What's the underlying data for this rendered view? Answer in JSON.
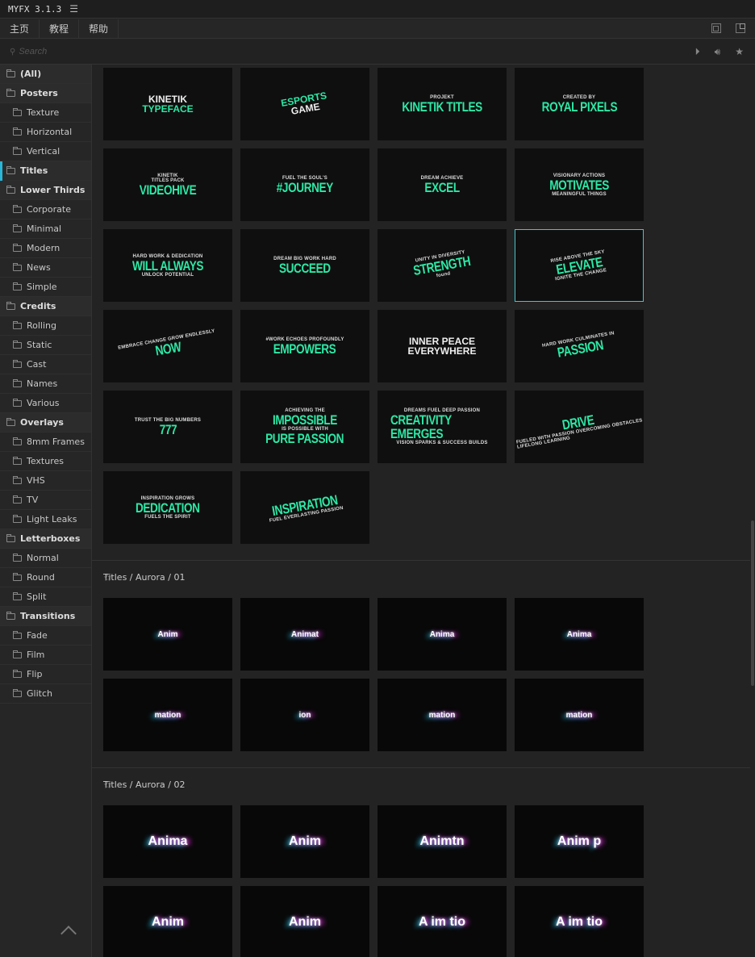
{
  "app": {
    "title": "MYFX 3.1.3",
    "menu_icon": "hamburger-icon"
  },
  "tabs": [
    "主页",
    "教程",
    "帮助"
  ],
  "search": {
    "placeholder": "Search"
  },
  "sidebar": [
    {
      "label": "(All)",
      "level": 0
    },
    {
      "label": "Posters",
      "level": 0
    },
    {
      "label": "Texture",
      "level": 1
    },
    {
      "label": "Horizontal",
      "level": 1
    },
    {
      "label": "Vertical",
      "level": 1
    },
    {
      "label": "Titles",
      "level": 0,
      "selected": true
    },
    {
      "label": "Lower Thirds",
      "level": 0
    },
    {
      "label": "Corporate",
      "level": 1
    },
    {
      "label": "Minimal",
      "level": 1
    },
    {
      "label": "Modern",
      "level": 1
    },
    {
      "label": "News",
      "level": 1
    },
    {
      "label": "Simple",
      "level": 1
    },
    {
      "label": "Credits",
      "level": 0
    },
    {
      "label": "Rolling",
      "level": 1
    },
    {
      "label": "Static",
      "level": 1
    },
    {
      "label": "Cast",
      "level": 1
    },
    {
      "label": "Names",
      "level": 1
    },
    {
      "label": "Various",
      "level": 1
    },
    {
      "label": "Overlays",
      "level": 0
    },
    {
      "label": "8mm Frames",
      "level": 1
    },
    {
      "label": "Textures",
      "level": 1
    },
    {
      "label": "VHS",
      "level": 1
    },
    {
      "label": "TV",
      "level": 1
    },
    {
      "label": "Light Leaks",
      "level": 1
    },
    {
      "label": "Letterboxes",
      "level": 0
    },
    {
      "label": "Normal",
      "level": 1
    },
    {
      "label": "Round",
      "level": 1
    },
    {
      "label": "Split",
      "level": 1
    },
    {
      "label": "Transitions",
      "level": 0
    },
    {
      "label": "Fade",
      "level": 1
    },
    {
      "label": "Film",
      "level": 1
    },
    {
      "label": "Flip",
      "level": 1
    },
    {
      "label": "Glitch",
      "level": 1
    }
  ],
  "titles_grid": [
    {
      "lines": [
        [
          "KINETIK",
          "md"
        ],
        [
          "TYPEFACE",
          "mg"
        ]
      ]
    },
    {
      "lines": [
        [
          "ESPORTS",
          "mg"
        ],
        [
          "GAME",
          "md"
        ]
      ],
      "rot": true
    },
    {
      "lines": [
        [
          "PROJEKT",
          "sm"
        ],
        [
          "KINETIK TITLES",
          "lg"
        ]
      ]
    },
    {
      "lines": [
        [
          "CREATED BY",
          "sm"
        ],
        [
          "ROYAL PIXELS",
          "lg"
        ]
      ]
    },
    {
      "lines": [
        [
          "KINETIK",
          "sm"
        ],
        [
          "TITLES PACK",
          "sm"
        ],
        [
          "VIDEOHIVE",
          "lg"
        ]
      ]
    },
    {
      "lines": [
        [
          "FUEL THE SOUL'S",
          "sm"
        ],
        [
          "#JOURNEY",
          "lg"
        ]
      ]
    },
    {
      "lines": [
        [
          "DREAM ACHIEVE",
          "sm"
        ],
        [
          "EXCEL",
          "lg"
        ]
      ]
    },
    {
      "lines": [
        [
          "VISIONARY ACTIONS",
          "sm"
        ],
        [
          "MOTIVATES",
          "lg"
        ],
        [
          "MEANINGFUL THINGS",
          "sm"
        ]
      ]
    },
    {
      "lines": [
        [
          "HARD WORK & DEDICATION",
          "sm"
        ],
        [
          "WILL ALWAYS",
          "lg"
        ],
        [
          "UNLOCK POTENTIAL",
          "sm"
        ]
      ]
    },
    {
      "lines": [
        [
          "DREAM BIG WORK HARD",
          "sm"
        ],
        [
          "SUCCEED",
          "lg"
        ]
      ]
    },
    {
      "lines": [
        [
          "UNITY IN DIVERSITY",
          "sm"
        ],
        [
          "STRENGTH",
          "lg"
        ],
        [
          "found",
          "sm"
        ]
      ],
      "rot": true
    },
    {
      "lines": [
        [
          "RISE ABOVE THE SKY",
          "sm"
        ],
        [
          "ELEVATE",
          "lg"
        ],
        [
          "IGNITE THE CHANGE",
          "sm"
        ]
      ],
      "rot": true,
      "selected": true
    },
    {
      "lines": [
        [
          "EMBRACE CHANGE GROW ENDLESSLY",
          "sm"
        ],
        [
          "NOW",
          "lg"
        ]
      ],
      "rot": true
    },
    {
      "lines": [
        [
          "#WORK ECHOES PROFOUNDLY",
          "sm"
        ],
        [
          "EMPOWERS",
          "lg"
        ]
      ]
    },
    {
      "lines": [
        [
          "INNER PEACE",
          "md"
        ],
        [
          "EVERYWHERE",
          "md"
        ]
      ]
    },
    {
      "lines": [
        [
          "HARD WORK CULMINATES IN",
          "sm"
        ],
        [
          "PASSION",
          "lg"
        ]
      ],
      "rot": true
    },
    {
      "lines": [
        [
          "TRUST THE BIG NUMBERS",
          "sm"
        ],
        [
          "777",
          "lg"
        ]
      ]
    },
    {
      "lines": [
        [
          "ACHIEVING THE",
          "sm"
        ],
        [
          "IMPOSSIBLE",
          "lg"
        ],
        [
          "IS POSSIBLE WITH",
          "sm"
        ],
        [
          "PURE PASSION",
          "lg"
        ]
      ]
    },
    {
      "lines": [
        [
          "DREAMS FUEL DEEP PASSION",
          "sm"
        ],
        [
          "CREATIVITY EMERGES",
          "lg"
        ],
        [
          "VISION SPARKS & SUCCESS BUILDS",
          "sm"
        ]
      ]
    },
    {
      "lines": [
        [
          "DRIVE",
          "lg"
        ],
        [
          "FUELED WITH PASSION OVERCOMING OBSTACLES LIFELONG LEARNING",
          "sm"
        ]
      ],
      "rot": true
    },
    {
      "lines": [
        [
          "INSPIRATION GROWS",
          "sm"
        ],
        [
          "DEDICATION",
          "lg"
        ],
        [
          "FUELS THE SPIRIT",
          "sm"
        ]
      ]
    },
    {
      "lines": [
        [
          "INSPIRATION",
          "lg"
        ],
        [
          "FUEL EVERLASTING PASSION",
          "sm"
        ]
      ],
      "rot": true
    }
  ],
  "sections": [
    {
      "title": "Titles / Aurora / 01",
      "tiles": [
        "Anim",
        "Animat",
        "Anima",
        "Anima",
        "mation",
        "ion",
        "mation",
        "mation"
      ]
    },
    {
      "title": "Titles / Aurora / 02",
      "tiles": [
        "Anima",
        "Anim",
        "Animtn",
        "Anim p",
        "Anim",
        "Anim",
        "A im tio",
        "A im tio"
      ]
    }
  ]
}
